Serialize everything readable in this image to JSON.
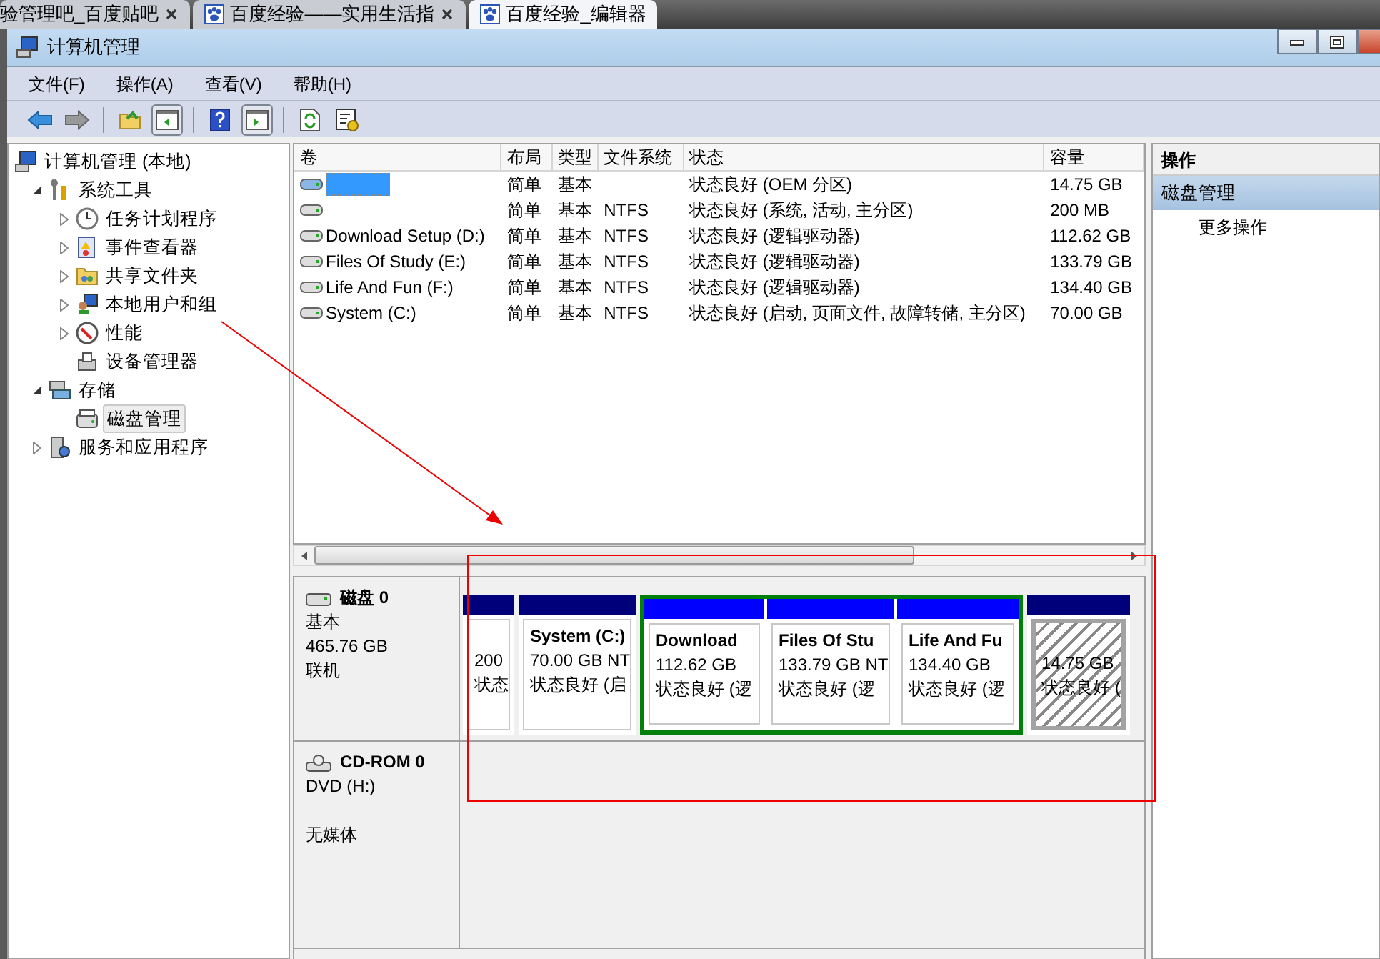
{
  "browser_tabs": [
    {
      "title": "验管理吧_百度贴吧",
      "selected": false,
      "icon_shown": false
    },
    {
      "title": "百度经验——实用生活指",
      "selected": false,
      "icon_shown": true
    },
    {
      "title": "百度经验_编辑器",
      "selected": true,
      "icon_shown": true
    }
  ],
  "window": {
    "title": "计算机管理"
  },
  "menu": [
    "文件(F)",
    "操作(A)",
    "查看(V)",
    "帮助(H)"
  ],
  "tree": [
    {
      "label": "计算机管理 (本地)",
      "expandable": false,
      "selected": false,
      "children": [
        {
          "label": "系统工具",
          "expandable": true,
          "expanded": true,
          "selected": false,
          "children": [
            {
              "label": "任务计划程序",
              "expandable": true,
              "expanded": false,
              "selected": false
            },
            {
              "label": "事件查看器",
              "expandable": true,
              "expanded": false,
              "selected": false
            },
            {
              "label": "共享文件夹",
              "expandable": true,
              "expanded": false,
              "selected": false
            },
            {
              "label": "本地用户和组",
              "expandable": true,
              "expanded": false,
              "selected": false
            },
            {
              "label": "性能",
              "expandable": true,
              "expanded": false,
              "selected": false
            },
            {
              "label": "设备管理器",
              "expandable": false,
              "selected": false
            }
          ]
        },
        {
          "label": "存储",
          "expandable": true,
          "expanded": true,
          "selected": false,
          "children": [
            {
              "label": "磁盘管理",
              "expandable": false,
              "selected": true
            }
          ]
        },
        {
          "label": "服务和应用程序",
          "expandable": true,
          "expanded": false,
          "selected": false
        }
      ]
    }
  ],
  "table": {
    "columns": [
      "卷",
      "布局",
      "类型",
      "文件系统",
      "状态",
      "容量"
    ],
    "rows": [
      {
        "redacted": true,
        "cells": [
          "",
          "简单",
          "基本",
          "",
          "状态良好 (OEM 分区)",
          "14.75 GB"
        ]
      },
      {
        "redacted": false,
        "cells": [
          "",
          "简单",
          "基本",
          "NTFS",
          "状态良好 (系统, 活动, 主分区)",
          "200 MB"
        ]
      },
      {
        "redacted": false,
        "cells": [
          "Download Setup (D:)",
          "简单",
          "基本",
          "NTFS",
          "状态良好 (逻辑驱动器)",
          "112.62 GB"
        ]
      },
      {
        "redacted": false,
        "cells": [
          "Files Of Study (E:)",
          "简单",
          "基本",
          "NTFS",
          "状态良好 (逻辑驱动器)",
          "133.79 GB"
        ]
      },
      {
        "redacted": false,
        "cells": [
          "Life And Fun (F:)",
          "简单",
          "基本",
          "NTFS",
          "状态良好 (逻辑驱动器)",
          "134.40 GB"
        ]
      },
      {
        "redacted": false,
        "cells": [
          "System (C:)",
          "简单",
          "基本",
          "NTFS",
          "状态良好 (启动, 页面文件, 故障转储, 主分区)",
          "70.00 GB"
        ]
      }
    ]
  },
  "disks": [
    {
      "name": "磁盘 0",
      "lines": [
        "基本",
        "465.76 GB",
        "联机"
      ],
      "partitions": [
        {
          "kind": "primary",
          "selected": false,
          "size": "200",
          "status": "状态"
        },
        {
          "kind": "primary",
          "selected": false,
          "name": "System (C:)",
          "size": "70.00 GB NT",
          "status": "状态良好 (启"
        },
        {
          "kind": "extended",
          "children": [
            {
              "kind": "logical",
              "selected": false,
              "name": "Download",
              "size": "112.62 GB",
              "status": "状态良好 (逻"
            },
            {
              "kind": "logical",
              "selected": false,
              "name": "Files Of Stu",
              "size": "133.79 GB NT",
              "status": "状态良好 (逻"
            },
            {
              "kind": "logical",
              "selected": false,
              "name": "Life And Fu",
              "size": "134.40 GB",
              "status": "状态良好 (逻"
            }
          ]
        },
        {
          "kind": "primary",
          "selected": true,
          "size": "14.75 GB",
          "status": "状态良好 ("
        }
      ]
    },
    {
      "name": "CD-ROM 0",
      "lines": [
        "DVD (H:)",
        "无媒体"
      ]
    }
  ],
  "actions": {
    "header": "操作",
    "section": "磁盘管理",
    "items": [
      "更多操作"
    ]
  }
}
